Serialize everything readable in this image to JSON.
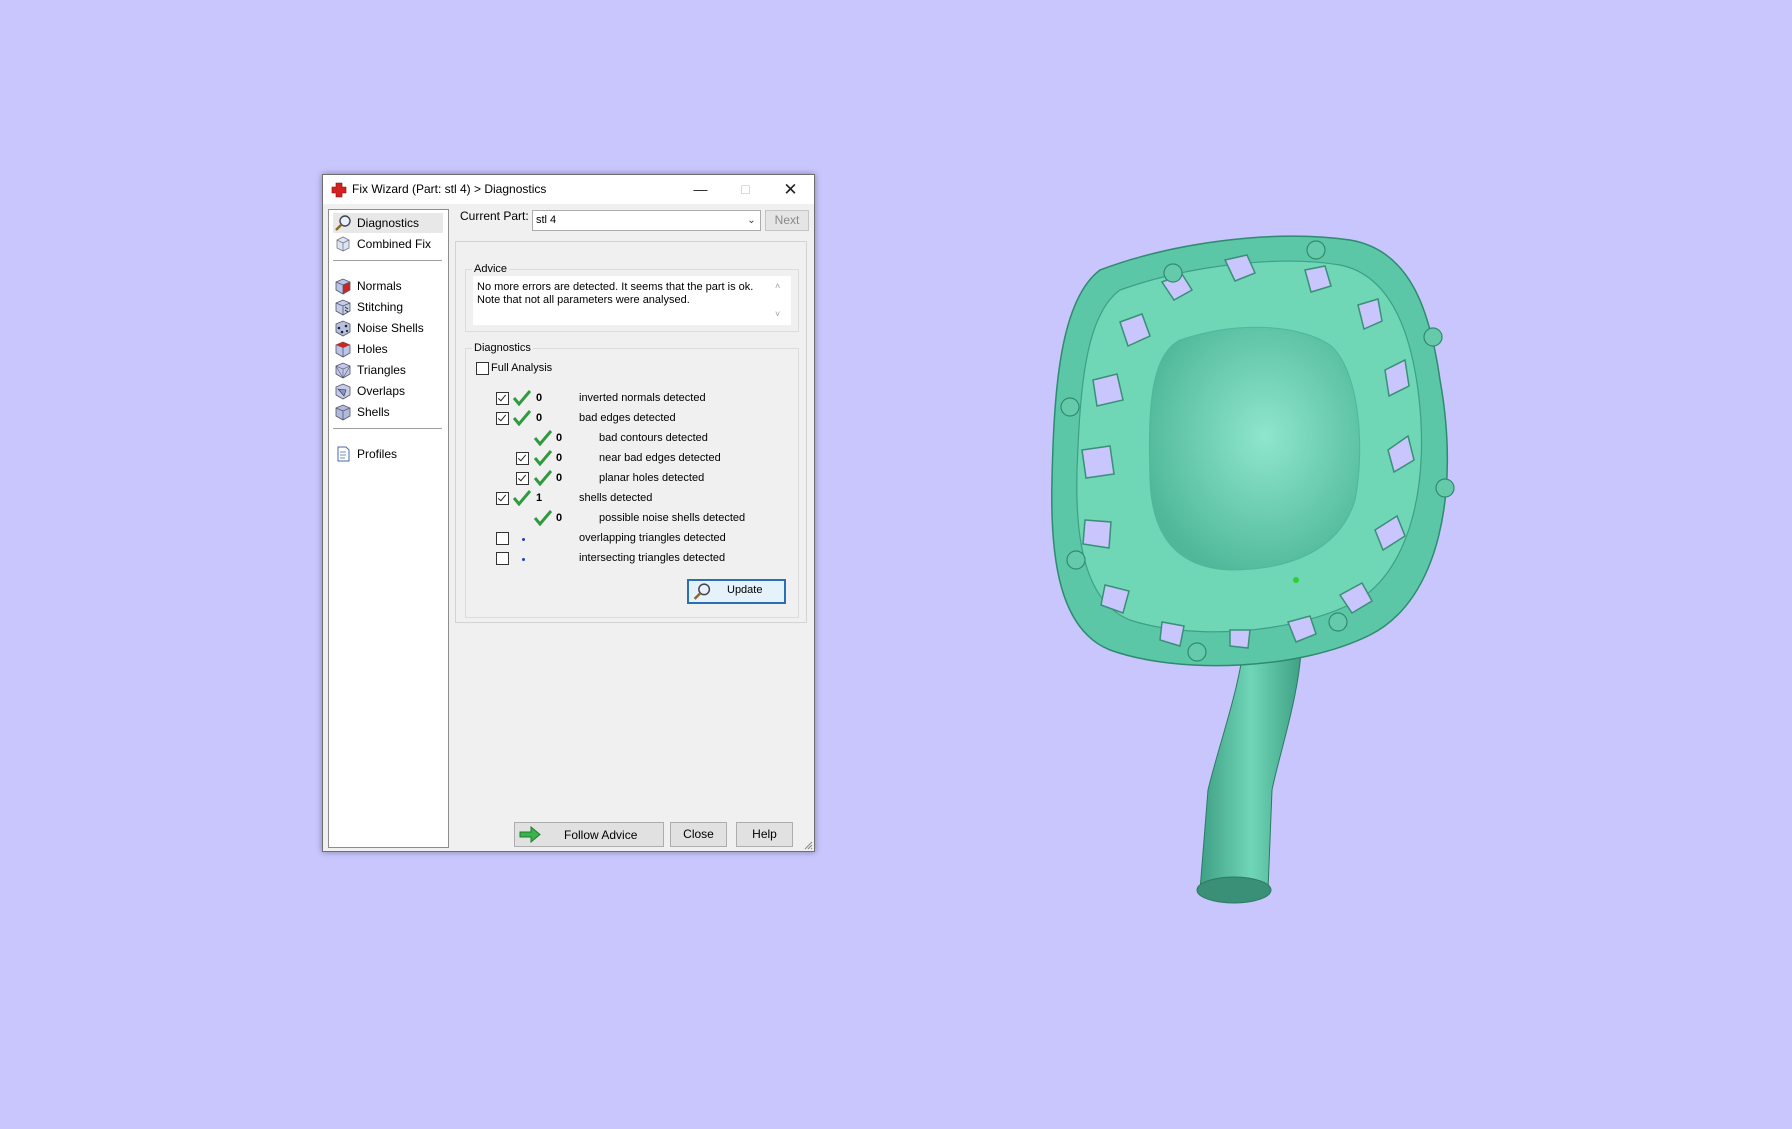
{
  "window": {
    "title": "Fix Wizard (Part: stl 4) > Diagnostics",
    "app_icon": "red-cross-icon"
  },
  "sidebar": {
    "items": [
      {
        "label": "Diagnostics",
        "icon": "magnifier-icon"
      },
      {
        "label": "Combined Fix",
        "icon": "cube-icon"
      },
      {
        "label": "Normals",
        "icon": "cube-red-face-icon"
      },
      {
        "label": "Stitching",
        "icon": "stitch-cube-icon"
      },
      {
        "label": "Noise Shells",
        "icon": "noise-cube-icon"
      },
      {
        "label": "Holes",
        "icon": "hole-cube-icon"
      },
      {
        "label": "Triangles",
        "icon": "triangle-cube-icon"
      },
      {
        "label": "Overlaps",
        "icon": "overlap-cube-icon"
      },
      {
        "label": "Shells",
        "icon": "shell-cube-icon"
      },
      {
        "label": "Profiles",
        "icon": "document-icon"
      }
    ]
  },
  "current_part": {
    "label": "Current Part:",
    "value": "stl 4",
    "next_label": "Next"
  },
  "advice": {
    "title": "Advice",
    "text": "No more errors are detected. It seems that the part is ok. Note that not all parameters were analysed."
  },
  "diagnostics": {
    "title": "Diagnostics",
    "full_analysis_label": "Full Analysis",
    "rows": [
      {
        "checked": true,
        "status": "ok",
        "count": "0",
        "label": "inverted normals detected"
      },
      {
        "checked": true,
        "status": "ok",
        "count": "0",
        "label": "bad edges detected"
      },
      {
        "checked": null,
        "status": "ok",
        "count": "0",
        "label": "bad contours detected"
      },
      {
        "checked": true,
        "status": "ok",
        "count": "0",
        "label": "near bad edges detected"
      },
      {
        "checked": true,
        "status": "ok",
        "count": "0",
        "label": "planar holes detected"
      },
      {
        "checked": true,
        "status": "ok",
        "count": "1",
        "label": "shells detected"
      },
      {
        "checked": null,
        "status": "ok",
        "count": "0",
        "label": "possible noise shells detected"
      },
      {
        "checked": false,
        "status": "unknown",
        "count": "",
        "label": "overlapping triangles detected"
      },
      {
        "checked": false,
        "status": "unknown",
        "count": "",
        "label": "intersecting triangles detected"
      }
    ],
    "update_label": "Update"
  },
  "footer": {
    "follow_advice_label": "Follow Advice",
    "close_label": "Close",
    "help_label": "Help"
  },
  "colors": {
    "background": "#c8c6fc",
    "model": "#6fd6b6",
    "check_green": "#2f9a3e"
  }
}
